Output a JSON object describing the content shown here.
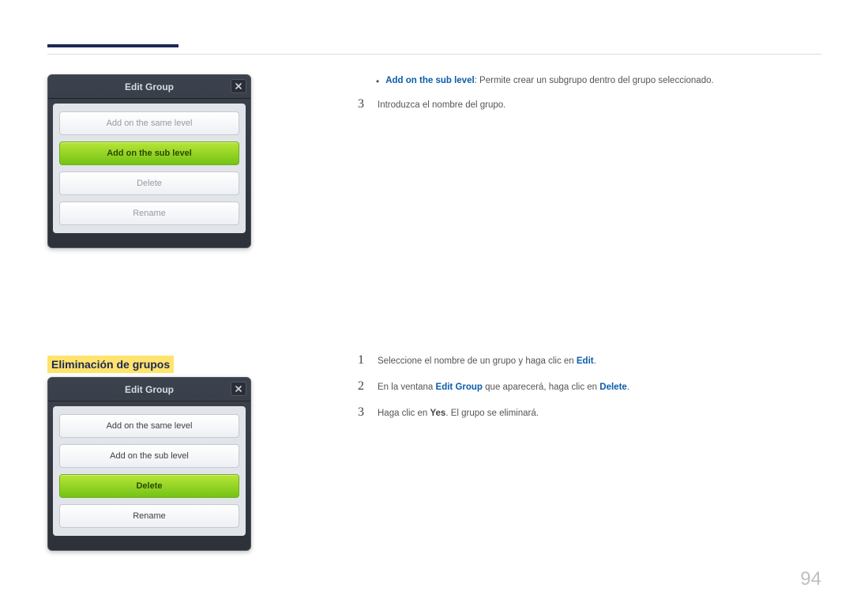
{
  "page_number": "94",
  "dialog1": {
    "title": "Edit Group",
    "options": {
      "same": "Add on the same level",
      "sub": "Add on the sub level",
      "delete": "Delete",
      "rename": "Rename"
    }
  },
  "top_right": {
    "bullet_label": "Add on the sub level",
    "bullet_rest": ": Permite crear un subgrupo dentro del grupo seleccionado.",
    "step3_num": "3",
    "step3_text": "Introduzca el nombre del grupo."
  },
  "section_heading": "Eliminación de grupos",
  "dialog2": {
    "title": "Edit Group",
    "options": {
      "same": "Add on the same level",
      "sub": "Add on the sub level",
      "delete": "Delete",
      "rename": "Rename"
    }
  },
  "steps2": {
    "s1_num": "1",
    "s1_a": "Seleccione el nombre de un grupo y haga clic en ",
    "s1_b": "Edit",
    "s1_c": ".",
    "s2_num": "2",
    "s2_a": "En la ventana ",
    "s2_b": "Edit Group",
    "s2_c": " que aparecerá, haga clic en ",
    "s2_d": "Delete",
    "s2_e": ".",
    "s3_num": "3",
    "s3_a": "Haga clic en ",
    "s3_b": "Yes",
    "s3_c": ". El grupo se eliminará."
  }
}
